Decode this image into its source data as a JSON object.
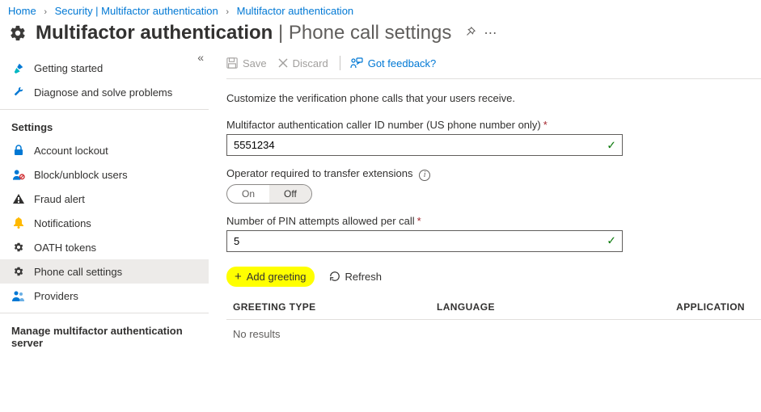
{
  "breadcrumb": {
    "home": "Home",
    "security": "Security | Multifactor authentication",
    "mfa": "Multifactor authentication"
  },
  "header": {
    "title_bold": "Multifactor authentication",
    "title_sep": " | ",
    "title_thin": "Phone call settings"
  },
  "sidebar": {
    "getting_started": "Getting started",
    "diagnose": "Diagnose and solve problems",
    "section_settings": "Settings",
    "account_lockout": "Account lockout",
    "block_unblock": "Block/unblock users",
    "fraud_alert": "Fraud alert",
    "notifications": "Notifications",
    "oath_tokens": "OATH tokens",
    "phone_call": "Phone call settings",
    "providers": "Providers",
    "section_manage": "Manage multifactor authentication server"
  },
  "toolbar": {
    "save": "Save",
    "discard": "Discard",
    "feedback": "Got feedback?"
  },
  "main": {
    "desc": "Customize the verification phone calls that your users receive.",
    "caller_id_label": "Multifactor authentication caller ID number (US phone number only)",
    "caller_id_value": "5551234",
    "operator_label": "Operator required to transfer extensions",
    "toggle_on": "On",
    "toggle_off": "Off",
    "pin_label": "Number of PIN attempts allowed per call",
    "pin_value": "5",
    "add_greeting": "Add greeting",
    "refresh": "Refresh",
    "col_type": "GREETING TYPE",
    "col_lang": "LANGUAGE",
    "col_app": "APPLICATION",
    "no_results": "No results"
  }
}
